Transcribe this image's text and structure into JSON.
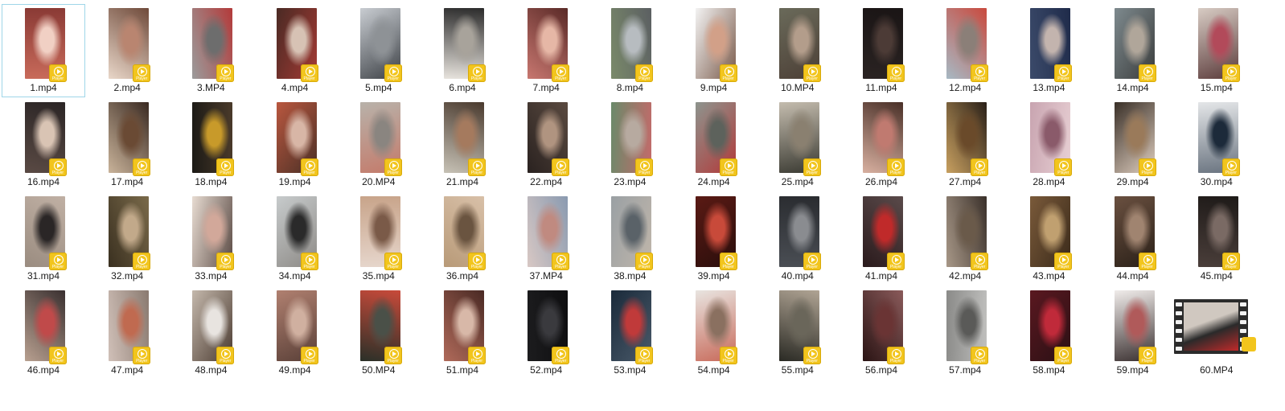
{
  "window": {
    "title": ""
  },
  "badge_label": "Player",
  "selected_index": 0,
  "files": [
    {
      "name": "1.mp4",
      "colors": [
        "#c86a5a",
        "#f1d0c4",
        "#8a3a35"
      ]
    },
    {
      "name": "2.mp4",
      "colors": [
        "#e9d7c9",
        "#b98570",
        "#6f4a3a"
      ]
    },
    {
      "name": "3.MP4",
      "colors": [
        "#9b9b9b",
        "#6d6d6d",
        "#b33a3a"
      ]
    },
    {
      "name": "4.mp4",
      "colors": [
        "#4a2a24",
        "#d7c2b4",
        "#a43a34"
      ]
    },
    {
      "name": "5.mp4",
      "colors": [
        "#c9cdd2",
        "#8e9296",
        "#3d4146"
      ]
    },
    {
      "name": "6.mp4",
      "colors": [
        "#e8e4de",
        "#a8a39b",
        "#2b2b2b"
      ]
    },
    {
      "name": "7.mp4",
      "colors": [
        "#c87770",
        "#e6b7a6",
        "#5a2a27"
      ]
    },
    {
      "name": "8.mp4",
      "colors": [
        "#7a8a6a",
        "#b7bcc0",
        "#5b5f62"
      ]
    },
    {
      "name": "9.mp4",
      "colors": [
        "#f3f3f3",
        "#d2a088",
        "#7a5a4a"
      ]
    },
    {
      "name": "10.MP4",
      "colors": [
        "#6a6a5a",
        "#b39d8b",
        "#4c3f36"
      ]
    },
    {
      "name": "11.mp4",
      "colors": [
        "#2a2322",
        "#4c3b36",
        "#1a1515"
      ]
    },
    {
      "name": "12.mp4",
      "colors": [
        "#a7b9c4",
        "#8b7f78",
        "#c94a3e"
      ]
    },
    {
      "name": "13.mp4",
      "colors": [
        "#3b4a6a",
        "#c3b4ae",
        "#1f2b4a"
      ]
    },
    {
      "name": "14.mp4",
      "colors": [
        "#7e8a8e",
        "#b0a69a",
        "#3a3c3c"
      ]
    },
    {
      "name": "15.mp4",
      "colors": [
        "#d8ccc4",
        "#b24a5a",
        "#5a3a3a"
      ]
    },
    {
      "name": "16.mp4",
      "colors": [
        "#5a4a44",
        "#d9c4b4",
        "#2b2525"
      ]
    },
    {
      "name": "17.mp4",
      "colors": [
        "#c9b39a",
        "#6a4a34",
        "#3a2a22"
      ]
    },
    {
      "name": "18.mp4",
      "colors": [
        "#1c1a16",
        "#c89a2a",
        "#4a3a2a"
      ]
    },
    {
      "name": "19.mp4",
      "colors": [
        "#b9573f",
        "#d8b6a6",
        "#4a3026"
      ]
    },
    {
      "name": "20.MP4",
      "colors": [
        "#b8b2aa",
        "#8a8580",
        "#c47a6a"
      ]
    },
    {
      "name": "21.mp4",
      "colors": [
        "#c7c2b6",
        "#a57a5e",
        "#4a3a2e"
      ]
    },
    {
      "name": "22.mp4",
      "colors": [
        "#2a2220",
        "#b09480",
        "#5a4a40"
      ]
    },
    {
      "name": "23.mp4",
      "colors": [
        "#6a8a6a",
        "#b7aaa0",
        "#c46a6a"
      ]
    },
    {
      "name": "24.mp4",
      "colors": [
        "#8d948e",
        "#5d625c",
        "#b23a3a"
      ]
    },
    {
      "name": "25.mp4",
      "colors": [
        "#c4bcae",
        "#8a8070",
        "#3a3a32"
      ]
    },
    {
      "name": "26.mp4",
      "colors": [
        "#d8b0a0",
        "#c07a70",
        "#4a3028"
      ]
    },
    {
      "name": "27.mp4",
      "colors": [
        "#c8a060",
        "#6a4a2a",
        "#2a2018"
      ]
    },
    {
      "name": "28.mp4",
      "colors": [
        "#c8a4b0",
        "#8a5a6a",
        "#e8d0d4"
      ]
    },
    {
      "name": "29.mp4",
      "colors": [
        "#3a3028",
        "#9a7a5a",
        "#e0cfc0"
      ]
    },
    {
      "name": "30.mp4",
      "colors": [
        "#e4e6e8",
        "#1c2a3a",
        "#6a7480"
      ]
    },
    {
      "name": "31.mp4",
      "colors": [
        "#9a8c80",
        "#2a2626",
        "#c0b0a4"
      ]
    },
    {
      "name": "32.mp4",
      "colors": [
        "#3a3020",
        "#c2a98a",
        "#7a6a4a"
      ]
    },
    {
      "name": "33.mp4",
      "colors": [
        "#e8dcd2",
        "#d2a89a",
        "#5a4a44"
      ]
    },
    {
      "name": "34.mp4",
      "colors": [
        "#c7cbcc",
        "#2a2a2a",
        "#8d8a86"
      ]
    },
    {
      "name": "35.mp4",
      "colors": [
        "#c8a48a",
        "#7a5a48",
        "#e6d6cc"
      ]
    },
    {
      "name": "36.mp4",
      "colors": [
        "#b89a78",
        "#6a5440",
        "#d8c0a8"
      ]
    },
    {
      "name": "37.MP4",
      "colors": [
        "#d8c8c4",
        "#c08a80",
        "#8a9ab0"
      ]
    },
    {
      "name": "38.mp4",
      "colors": [
        "#9aa0a4",
        "#5a6268",
        "#c0b6aa"
      ]
    },
    {
      "name": "39.mp4",
      "colors": [
        "#5a1a14",
        "#c84a3a",
        "#2a0e0c"
      ]
    },
    {
      "name": "40.mp4",
      "colors": [
        "#4a4e54",
        "#8a8c90",
        "#2a2c30"
      ]
    },
    {
      "name": "41.mp4",
      "colors": [
        "#2a1a1c",
        "#c02a2a",
        "#5a4a4a"
      ]
    },
    {
      "name": "42.mp4",
      "colors": [
        "#a89888",
        "#6a5a4a",
        "#3a302a"
      ]
    },
    {
      "name": "43.mp4",
      "colors": [
        "#7a5a3a",
        "#c0a070",
        "#3a2a1a"
      ]
    },
    {
      "name": "44.mp4",
      "colors": [
        "#6a5040",
        "#a08470",
        "#2a2018"
      ]
    },
    {
      "name": "45.mp4",
      "colors": [
        "#4a3e3a",
        "#7a6a64",
        "#1e1a18"
      ]
    },
    {
      "name": "46.mp4",
      "colors": [
        "#b8a090",
        "#c04a4a",
        "#3a3030"
      ]
    },
    {
      "name": "47.mp4",
      "colors": [
        "#d0c0b8",
        "#c06a50",
        "#8a7a70"
      ]
    },
    {
      "name": "48.mp4",
      "colors": [
        "#c4b8ac",
        "#e8e4e0",
        "#4a3a30"
      ]
    },
    {
      "name": "49.mp4",
      "colors": [
        "#b08070",
        "#d0b0a0",
        "#5a4038"
      ]
    },
    {
      "name": "50.MP4",
      "colors": [
        "#2a3028",
        "#4a5048",
        "#c84a3a"
      ]
    },
    {
      "name": "51.mp4",
      "colors": [
        "#b06a5a",
        "#d8b8a8",
        "#4a2a24"
      ]
    },
    {
      "name": "52.mp4",
      "colors": [
        "#1c1c1e",
        "#3a3a3e",
        "#0e0e10"
      ]
    },
    {
      "name": "53.mp4",
      "colors": [
        "#1a2a3a",
        "#c03a3a",
        "#4a5a6a"
      ]
    },
    {
      "name": "54.mp4",
      "colors": [
        "#e8e4e0",
        "#8a7060",
        "#c86a5a"
      ]
    },
    {
      "name": "55.mp4",
      "colors": [
        "#2a2a24",
        "#6a665a",
        "#b0a494"
      ]
    },
    {
      "name": "56.mp4",
      "colors": [
        "#2a1414",
        "#6a3434",
        "#8a5a5a"
      ]
    },
    {
      "name": "57.mp4",
      "colors": [
        "#8a8a88",
        "#5a5a58",
        "#c0c0be"
      ]
    },
    {
      "name": "58.mp4",
      "colors": [
        "#5a1820",
        "#c02a3a",
        "#2a1014"
      ]
    },
    {
      "name": "59.mp4",
      "colors": [
        "#f0ecea",
        "#b05a5a",
        "#3a3030"
      ]
    },
    {
      "name": "60.MP4",
      "colors": [
        "#d0c8c0",
        "#c02a2a",
        "#2a2a2a"
      ],
      "wide": true
    }
  ]
}
